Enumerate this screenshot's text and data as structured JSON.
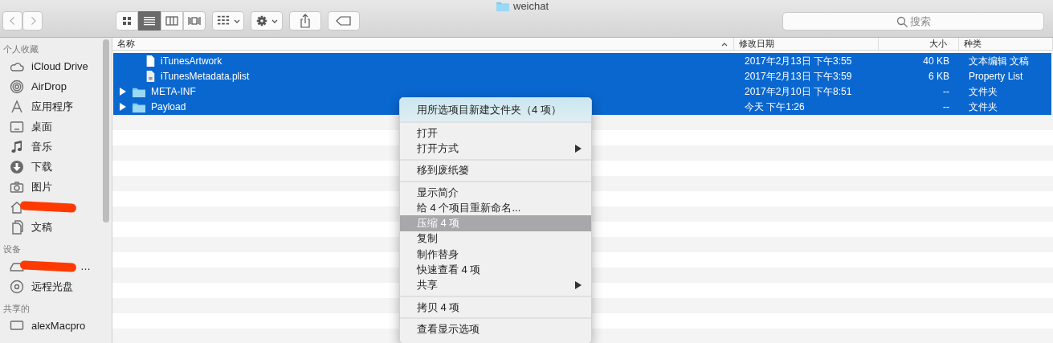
{
  "window": {
    "title": "weichat"
  },
  "toolbar": {
    "views": [
      {
        "kind": "icons",
        "selected": false
      },
      {
        "kind": "list",
        "selected": true
      },
      {
        "kind": "columns",
        "selected": false
      },
      {
        "kind": "coverflow",
        "selected": false
      }
    ],
    "search": {
      "placeholder": "搜索"
    }
  },
  "sidebar": {
    "sections": [
      {
        "heading": "个人收藏",
        "items": [
          {
            "kind": "cloud",
            "label": "iCloud Drive"
          },
          {
            "kind": "airdrop",
            "label": "AirDrop"
          },
          {
            "kind": "apps",
            "label": "应用程序"
          },
          {
            "kind": "desktop",
            "label": "桌面"
          },
          {
            "kind": "music",
            "label": "音乐"
          },
          {
            "kind": "download",
            "label": "下载"
          },
          {
            "kind": "pictures",
            "label": "图片"
          },
          {
            "kind": "home",
            "redacted": true
          },
          {
            "kind": "documents",
            "label": "文稿"
          }
        ]
      },
      {
        "heading": "设备",
        "items": [
          {
            "kind": "disk",
            "redacted": true,
            "label": "…"
          },
          {
            "kind": "disc",
            "label": "远程光盘"
          }
        ]
      },
      {
        "heading": "共享的",
        "items": [
          {
            "kind": "computer",
            "label": "alexMacpro"
          }
        ]
      }
    ]
  },
  "table": {
    "columns": [
      {
        "label": "名称",
        "sorted": true
      },
      {
        "label": "修改日期",
        "sorted": false
      },
      {
        "label": "大小",
        "sorted": false
      },
      {
        "label": "种类",
        "sorted": false
      }
    ],
    "rows": [
      {
        "kind": "file",
        "expandable": false,
        "selected": true,
        "name": "iTunesArtwork",
        "date": "2017年2月13日 下午3:55",
        "size": "40 KB",
        "type": "文本编辑 文稿"
      },
      {
        "kind": "plist",
        "expandable": false,
        "selected": true,
        "name": "iTunesMetadata.plist",
        "date": "2017年2月13日 下午3:59",
        "size": "6 KB",
        "type": "Property List"
      },
      {
        "kind": "folder",
        "expandable": true,
        "selected": true,
        "name": "META-INF",
        "date": "2017年2月10日 下午8:51",
        "size": "--",
        "type": "文件夹"
      },
      {
        "kind": "folder",
        "expandable": true,
        "selected": true,
        "name": "Payload",
        "date": "今天 下午1:26",
        "size": "--",
        "type": "文件夹"
      }
    ]
  },
  "context_menu": {
    "groups": [
      {
        "kind": "featured",
        "items": [
          {
            "label": "用所选项目新建文件夹（4 项）",
            "submenu": false,
            "selected": false
          }
        ]
      },
      {
        "kind": "normal",
        "items": [
          {
            "label": "打开",
            "submenu": false,
            "selected": false
          },
          {
            "label": "打开方式",
            "submenu": true,
            "selected": false
          }
        ]
      },
      {
        "kind": "normal",
        "items": [
          {
            "label": "移到废纸篓",
            "submenu": false,
            "selected": false
          }
        ]
      },
      {
        "kind": "normal",
        "items": [
          {
            "label": "显示简介",
            "submenu": false,
            "selected": false
          },
          {
            "label": "给 4 个项目重新命名...",
            "submenu": false,
            "selected": false
          },
          {
            "label": "压缩 4 项",
            "submenu": false,
            "selected": true
          },
          {
            "label": "复制",
            "submenu": false,
            "selected": false
          },
          {
            "label": "制作替身",
            "submenu": false,
            "selected": false
          },
          {
            "label": "快速查看 4 项",
            "submenu": false,
            "selected": false
          },
          {
            "label": "共享",
            "submenu": true,
            "selected": false
          }
        ]
      },
      {
        "kind": "normal",
        "items": [
          {
            "label": "拷贝 4 项",
            "submenu": false,
            "selected": false
          }
        ]
      },
      {
        "kind": "normal",
        "items": [
          {
            "label": "查看显示选项",
            "submenu": false,
            "selected": false
          }
        ]
      }
    ]
  }
}
